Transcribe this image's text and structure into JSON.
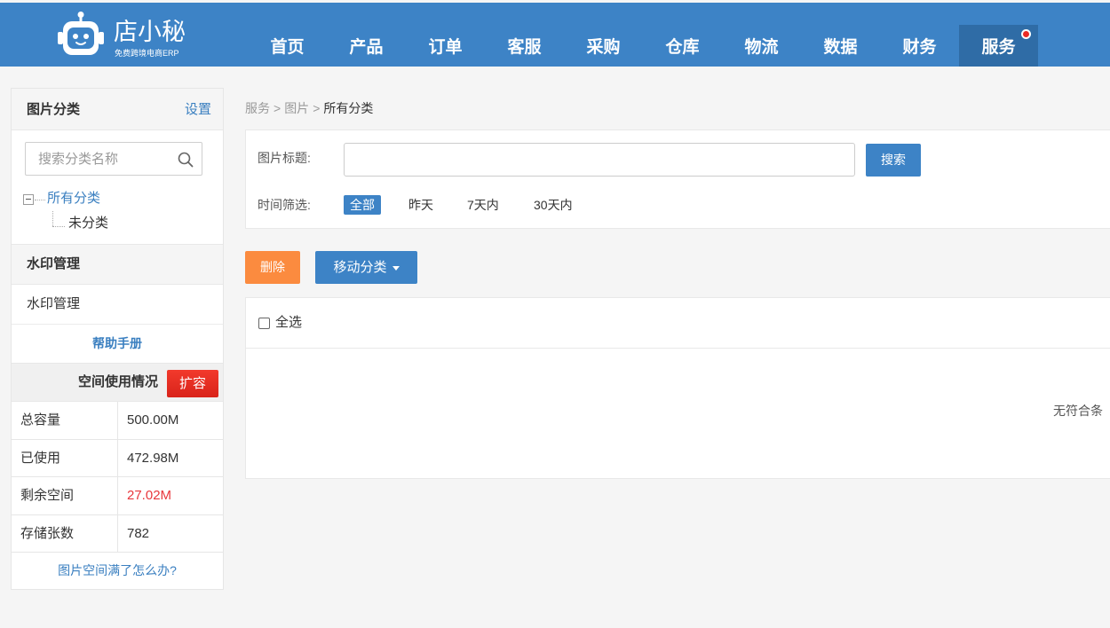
{
  "colors": {
    "primary": "#3d83c6",
    "primary_active": "#2f6ca6",
    "link": "#3a7fc0",
    "danger_button": "#e52d22",
    "warning_button": "#fb8b3f",
    "alert_text": "#e8373c",
    "notification_dot": "#ec2b25"
  },
  "header": {
    "logo": {
      "icon": "robot-logo-icon",
      "name": "店小秘",
      "tagline": "免费跨境电商ERP"
    },
    "nav": [
      {
        "label": "首页"
      },
      {
        "label": "产品"
      },
      {
        "label": "订单"
      },
      {
        "label": "客服"
      },
      {
        "label": "采购"
      },
      {
        "label": "仓库"
      },
      {
        "label": "物流"
      },
      {
        "label": "数据"
      },
      {
        "label": "财务"
      },
      {
        "label": "服务",
        "active": true,
        "has_notification": true
      }
    ]
  },
  "sidebar": {
    "categories": {
      "title": "图片分类",
      "settings_label": "设置",
      "search": {
        "placeholder": "搜索分类名称",
        "value": "",
        "icon": "search-icon"
      },
      "tree": {
        "root_label": "所有分类",
        "root_expanded": true,
        "children": [
          {
            "label": "未分类"
          }
        ]
      }
    },
    "watermark": {
      "title": "水印管理",
      "items": [
        {
          "label": "水印管理"
        }
      ]
    },
    "help_label": "帮助手册",
    "storage": {
      "title": "空间使用情况",
      "expand_label": "扩容",
      "rows": [
        {
          "label": "总容量",
          "value": "500.00M"
        },
        {
          "label": "已使用",
          "value": "472.98M"
        },
        {
          "label": "剩余空间",
          "value": "27.02M",
          "highlight": true
        },
        {
          "label": "存储张数",
          "value": "782"
        }
      ]
    },
    "faq_link": "图片空间满了怎么办?"
  },
  "main": {
    "breadcrumb": {
      "items": [
        "服务",
        "图片",
        "所有分类"
      ],
      "separator": ">"
    },
    "filters": {
      "title_label": "图片标题:",
      "title_value": "",
      "search_label": "搜索",
      "time_label": "时间筛选:",
      "time_options": [
        "全部",
        "昨天",
        "7天内",
        "30天内"
      ],
      "time_selected_index": 0
    },
    "actions": {
      "delete_label": "删除",
      "move_label": "移动分类",
      "move_icon": "chevron-down-icon"
    },
    "results": {
      "select_all_label": "全选",
      "select_all_checked": false,
      "empty_text": "无符合条"
    }
  }
}
